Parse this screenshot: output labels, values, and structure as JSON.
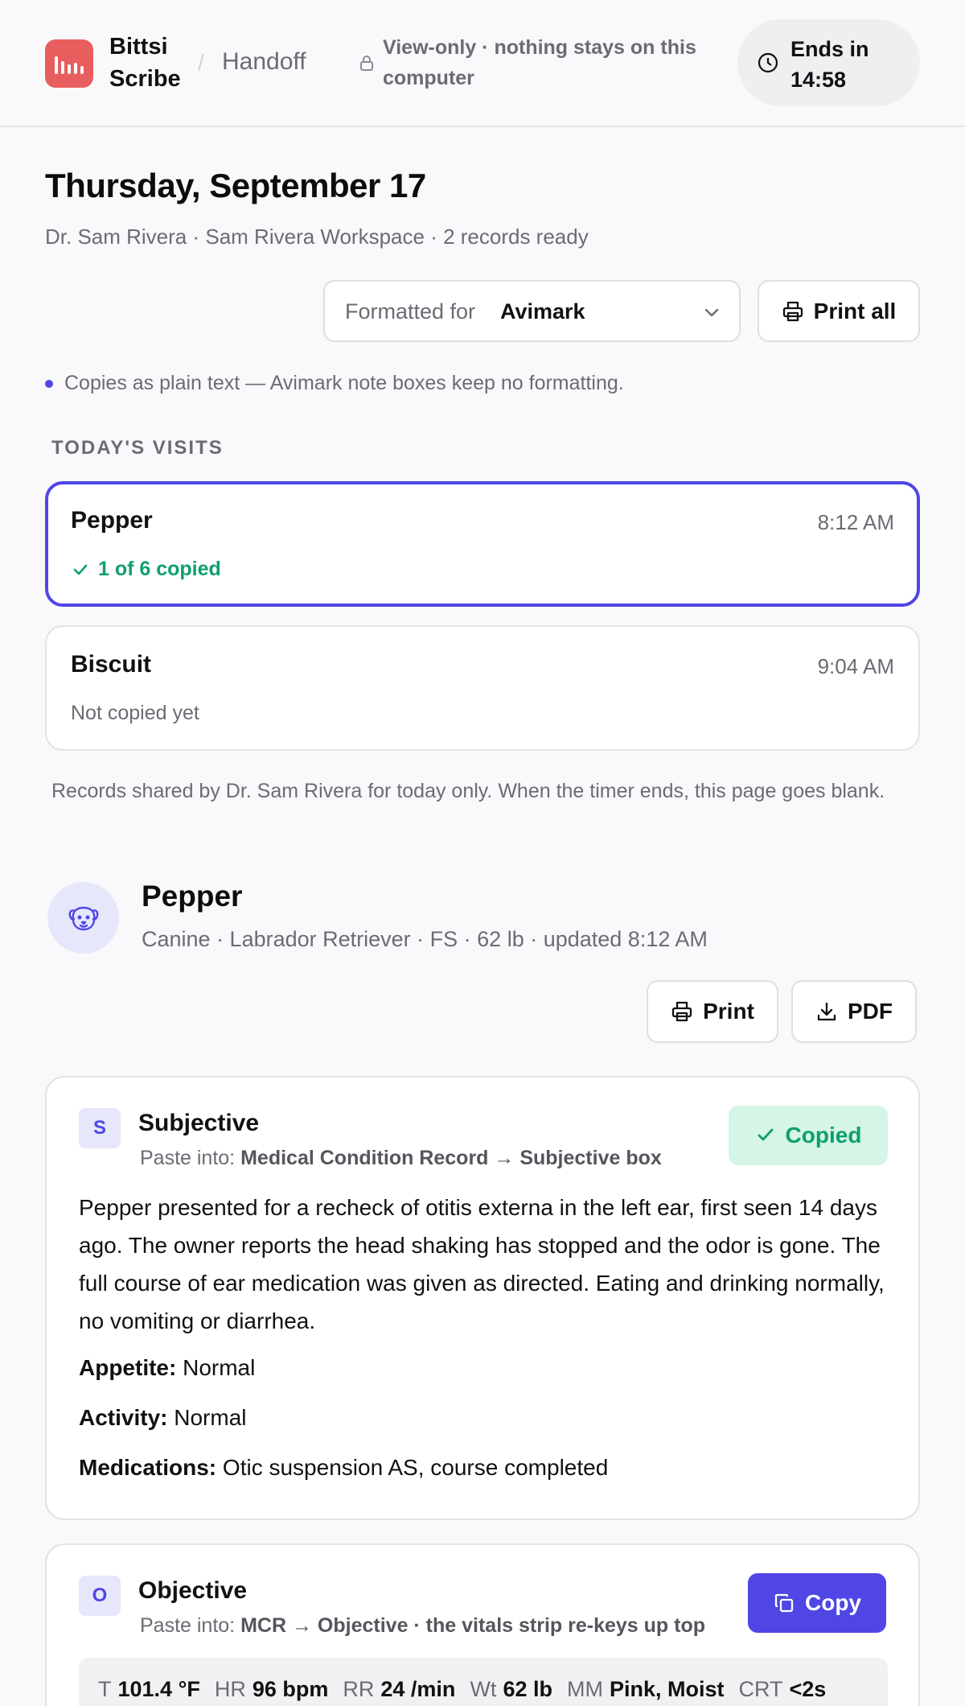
{
  "header": {
    "brand": "Bittsi Scribe",
    "section": "Handoff",
    "notice": "View-only · nothing stays on this computer",
    "timer": "Ends in 14:58"
  },
  "page": {
    "title": "Thursday, September 17",
    "subtitle": "Dr. Sam Rivera · Sam Rivera Workspace · 2 records ready"
  },
  "toolbar": {
    "format_label": "Formatted for",
    "format_value": "Avimark",
    "print_all": "Print all",
    "format_note": "Copies as plain text — Avimark note boxes keep no formatting."
  },
  "visits": {
    "label": "TODAY'S VISITS",
    "items": [
      {
        "name": "Pepper",
        "time": "8:12 AM",
        "status": "1 of 6 copied"
      },
      {
        "name": "Biscuit",
        "time": "9:04 AM",
        "status": "Not copied yet"
      }
    ],
    "disclaimer": "Records shared by Dr. Sam Rivera for today only. When the timer ends, this page goes blank."
  },
  "patient": {
    "name": "Pepper",
    "meta": "Canine · Labrador Retriever · FS · 62 lb · updated 8:12 AM",
    "print": "Print",
    "pdf": "PDF"
  },
  "subjective": {
    "badge": "S",
    "title": "Subjective",
    "paste_prefix": "Paste into:",
    "paste_target": "Medical Condition Record → Subjective box",
    "status": "Copied",
    "body": "Pepper presented for a recheck of otitis externa in the left ear, first seen 14 days ago. The owner reports the head shaking has stopped and the odor is gone. The full course of ear medication was given as directed. Eating and drinking normally, no vomiting or diarrhea.",
    "fields": [
      {
        "label": "Appetite:",
        "value": "Normal"
      },
      {
        "label": "Activity:",
        "value": "Normal"
      },
      {
        "label": "Medications:",
        "value": "Otic suspension AS, course completed"
      }
    ]
  },
  "objective": {
    "badge": "O",
    "title": "Objective",
    "paste_prefix": "Paste into:",
    "paste_target": "MCR → Objective · the vitals strip re-keys up top",
    "copy": "Copy",
    "vitals": [
      {
        "key": "T",
        "value": "101.4 °F"
      },
      {
        "key": "HR",
        "value": "96 bpm"
      },
      {
        "key": "RR",
        "value": "24 /min"
      },
      {
        "key": "Wt",
        "value": "62 lb"
      },
      {
        "key": "MM",
        "value": "Pink, Moist"
      },
      {
        "key": "CRT",
        "value": "<2s"
      }
    ]
  },
  "colors": {
    "accent": "#4f46e5",
    "success": "#0e9f6e",
    "logo": "#e85d5d"
  },
  "icons": [
    "bars-logo-icon",
    "lock-icon",
    "clock-icon",
    "chevron-down-icon",
    "printer-icon",
    "check-icon",
    "dog-icon",
    "download-icon",
    "copy-icon"
  ]
}
